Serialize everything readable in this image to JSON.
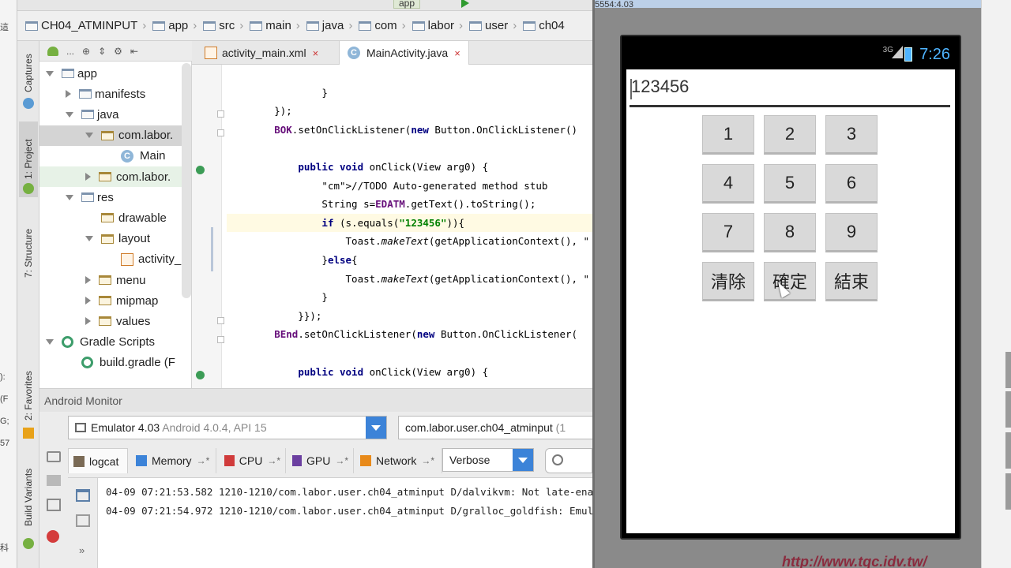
{
  "desktop_left": {
    "fragments": [
      "這",
      "):",
      "(F",
      "G;",
      "57",
      "科"
    ]
  },
  "toolbar": {
    "run_config": "app"
  },
  "breadcrumb": [
    "CH04_ATMINPUT",
    "app",
    "src",
    "main",
    "java",
    "com",
    "labor",
    "user",
    "ch04"
  ],
  "tool_strip": {
    "captures": "Captures",
    "project": "1: Project",
    "structure": "7: Structure",
    "favorites": "2: Favorites",
    "build_variants": "Build Variants"
  },
  "project_toolbar": {
    "label": "..."
  },
  "project_tree": [
    {
      "label": "app",
      "indent": 0,
      "arrow": "down",
      "icon": "folder"
    },
    {
      "label": "manifests",
      "indent": 1,
      "arrow": "right",
      "icon": "folder"
    },
    {
      "label": "java",
      "indent": 1,
      "arrow": "down",
      "icon": "folder"
    },
    {
      "label": "com.labor.",
      "indent": 2,
      "arrow": "down",
      "icon": "package",
      "selected": true
    },
    {
      "label": "Main",
      "indent": 3,
      "arrow": "none",
      "icon": "class"
    },
    {
      "label": "com.labor.",
      "indent": 2,
      "arrow": "right",
      "icon": "package",
      "highlight": true
    },
    {
      "label": "res",
      "indent": 1,
      "arrow": "down",
      "icon": "folder"
    },
    {
      "label": "drawable",
      "indent": 2,
      "arrow": "none",
      "icon": "package"
    },
    {
      "label": "layout",
      "indent": 2,
      "arrow": "down",
      "icon": "package"
    },
    {
      "label": "activity_",
      "indent": 3,
      "arrow": "none",
      "icon": "xml"
    },
    {
      "label": "menu",
      "indent": 2,
      "arrow": "right",
      "icon": "package"
    },
    {
      "label": "mipmap",
      "indent": 2,
      "arrow": "right",
      "icon": "package"
    },
    {
      "label": "values",
      "indent": 2,
      "arrow": "right",
      "icon": "package"
    },
    {
      "label": "Gradle Scripts",
      "indent": 0,
      "arrow": "down",
      "icon": "gradle"
    },
    {
      "label": "build.gradle (F",
      "indent": 1,
      "arrow": "none",
      "icon": "gradle"
    }
  ],
  "editor_tabs": [
    {
      "label": "activity_main.xml",
      "close": "×",
      "active": false
    },
    {
      "label": "MainActivity.java",
      "close": "×",
      "active": true
    }
  ],
  "code_lines": [
    "",
    "                }",
    "        });",
    "        BOK.setOnClickListener(new Button.OnClickListener()",
    "",
    "            public void onClick(View arg0) {",
    "                //TODO Auto-generated method stub",
    "                String s=EDATM.getText().toString();",
    "                if (s.equals(\"123456\")){",
    "                    Toast.makeText(getApplicationContext(), \"",
    "                }else{",
    "                    Toast.makeText(getApplicationContext(), \"",
    "                }",
    "            }});",
    "        BEnd.setOnClickListener(new Button.OnClickListener(",
    "",
    "            public void onClick(View arg0) {"
  ],
  "android_monitor": {
    "title": "Android Monitor",
    "device_name": "Emulator 4.03",
    "device_detail": "Android 4.0.4, API 15",
    "process": "com.labor.user.ch04_atminput",
    "process_suffix": "(1",
    "tabs": [
      {
        "label": "logcat",
        "pin": "",
        "icon_color": "#7a6a55",
        "active": true
      },
      {
        "label": "Memory",
        "pin": "→*",
        "icon_color": "#3c83d8",
        "active": false
      },
      {
        "label": "CPU",
        "pin": "→*",
        "icon_color": "#d03b3b",
        "active": false
      },
      {
        "label": "GPU",
        "pin": "→*",
        "icon_color": "#6b3fa0",
        "active": false
      },
      {
        "label": "Network",
        "pin": "→*",
        "icon_color": "#e88a1a",
        "active": false
      }
    ],
    "log_level": "Verbose",
    "log_lines": [
      "04-09 07:21:53.582 1210-1210/com.labor.user.ch04_atminput D/dalvikvm: Not late-ena",
      "04-09 07:21:54.972 1210-1210/com.labor.user.ch04_atminput D/gralloc_goldfish: Emul"
    ],
    "more": "»"
  },
  "emulator": {
    "window_title": "5554:4.03",
    "status": {
      "network": "3G",
      "time": "7:26"
    },
    "input_value": "123456",
    "keypad": [
      "1",
      "2",
      "3",
      "4",
      "5",
      "6",
      "7",
      "8",
      "9",
      "清除",
      "確定",
      "結束"
    ]
  },
  "watermark": "http://www.tqc.idv.tw/"
}
